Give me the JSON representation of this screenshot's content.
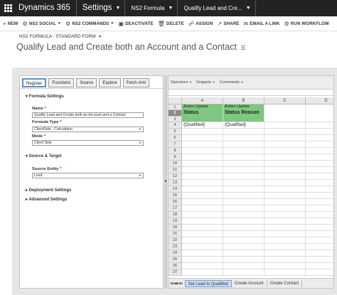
{
  "topnav": {
    "brand": "Dynamics 365",
    "area": "Settings",
    "breadcrumb1": "NS2 Formula",
    "breadcrumb2": "Qualify Lead and Cre..."
  },
  "commands": [
    {
      "icon": "+",
      "label": "NEW"
    },
    {
      "icon": "⚙",
      "label": "NS2 SOCIAL",
      "dropdown": true
    },
    {
      "icon": "⚙",
      "label": "NS2 COMMANDS",
      "dropdown": true
    },
    {
      "icon": "▣",
      "label": "DEACTIVATE"
    },
    {
      "icon": "🗑",
      "label": "DELETE"
    },
    {
      "icon": "☍",
      "label": "ASSIGN"
    },
    {
      "icon": "↗",
      "label": "SHARE"
    },
    {
      "icon": "✉",
      "label": "EMAIL A LINK"
    },
    {
      "icon": "⚙",
      "label": "RUN WORKFLOW"
    }
  ],
  "form": {
    "label": "NS2 FORMULA : STANDARD FORM",
    "title": "Qualify Lead and Create both an Account and a Contact"
  },
  "left_tabs": [
    "Register",
    "Functions",
    "Source",
    "Explore",
    "Fetch-Xml"
  ],
  "formula_settings": {
    "header": "Formula Settings",
    "name_label": "Name",
    "name_value": "Qualify Lead and Create both an Account and a Contact",
    "type_label": "Formula Type",
    "type_value": "ClientSide - Calculation",
    "mode_label": "Mode",
    "mode_value": "Client Side"
  },
  "source_target": {
    "header": "Source & Target",
    "entity_label": "Source Entity",
    "entity_value": "Lead"
  },
  "deployment_header": "Deployment Settings",
  "advanced_header": "Advanced Settings",
  "sheet_menu": [
    "Operators",
    "Snippets",
    "Commands"
  ],
  "columns": [
    "A",
    "B",
    "C",
    "D"
  ],
  "rows": [
    "1",
    "2",
    "3",
    "4",
    "5",
    "6",
    "7",
    "8",
    "9",
    "10",
    "11",
    "12",
    "13",
    "14",
    "15",
    "16",
    "17",
    "18",
    "19",
    "20",
    "21",
    "22",
    "23",
    "24",
    "25",
    "26",
    "27"
  ],
  "cells": {
    "a1_2_top": "Action-Update",
    "a1_2_bottom": "Status",
    "b1_2_top": "Action-Update",
    "b1_2_bottom": "Status Reason",
    "a4": "{Qualified}",
    "b4": "{Qualified}"
  },
  "sheet_tabs": [
    "Set Lead to Qualified",
    "Create Account",
    "Create Contact"
  ],
  "sheet_nav": "|◀ ◀ ▶ ▶|",
  "colors": {
    "header_bg": "#232323",
    "green_cell": "#7ec77e",
    "active_tab": "#5d8fce"
  }
}
